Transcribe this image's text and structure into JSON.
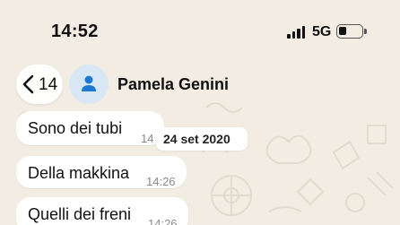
{
  "status_bar": {
    "time": "14:52",
    "network": "5G",
    "signal_icon": "signal-bars-icon",
    "battery_icon": "battery-icon"
  },
  "header": {
    "back_count": "14",
    "contact_name": "Pamela Genini",
    "back_icon": "chevron-left-icon",
    "avatar_icon": "person-icon"
  },
  "date_separator": "24 set 2020",
  "messages": [
    {
      "text": "Sono dei tubi",
      "time": "14"
    },
    {
      "text": "Della makkina",
      "time": "14:26"
    },
    {
      "text": "Quelli dei freni",
      "time": "14:26"
    }
  ],
  "colors": {
    "background": "#f2ece2",
    "bubble": "#ffffff",
    "avatar_bg": "#d9e7f5",
    "avatar_icon": "#1f78d1"
  }
}
